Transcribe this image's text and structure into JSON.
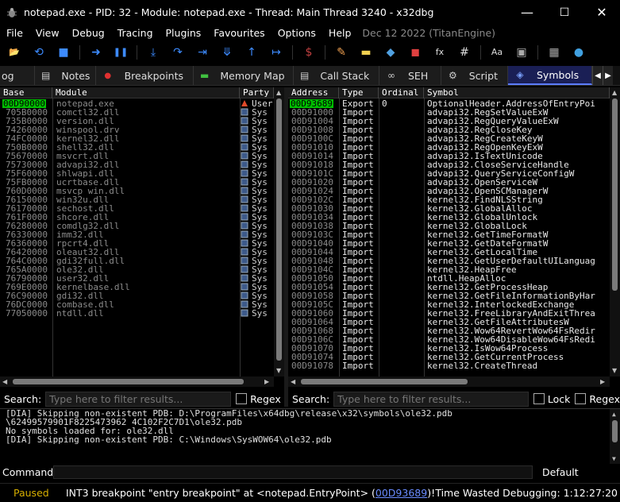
{
  "window": {
    "title": "notepad.exe - PID: 32 - Module: notepad.exe - Thread: Main Thread 3240 - x32dbg",
    "minimize": "—",
    "maximize": "☐",
    "close": "✕"
  },
  "menu": {
    "items": [
      "File",
      "View",
      "Debug",
      "Tracing",
      "Plugins",
      "Favourites",
      "Options",
      "Help"
    ],
    "date": "Dec 12 2022 (TitanEngine)"
  },
  "toolbar": {
    "icons": [
      "open-icon",
      "restart-icon",
      "stop-icon",
      "run-icon",
      "pause-icon",
      "step-into-icon",
      "step-over-icon",
      "trace-into-icon",
      "trace-over-icon",
      "execute-till-return-icon",
      "run-to-user-code-icon",
      "script-icon",
      "patch-icon",
      "comment-icon",
      "label-icon",
      "bookmark-icon",
      "function-icon",
      "hash-icon",
      "font-icon",
      "memory-icon",
      "calculator-icon",
      "globe-icon"
    ],
    "glyphs": [
      "📂",
      "⟲",
      "■",
      "➜",
      "❚❚",
      "⤓",
      "↷",
      "⇥",
      "⤋",
      "↑",
      "↦",
      "$",
      "✎",
      "▬",
      "◆",
      "◼",
      "fx",
      "#",
      "Aa",
      "▣",
      "▦",
      "●"
    ],
    "colors": [
      "#e0a030",
      "#3d8bff",
      "#3d8bff",
      "#3d8bff",
      "#3d8bff",
      "#3d8bff",
      "#3d8bff",
      "#3d8bff",
      "#3d8bff",
      "#3d8bff",
      "#3d8bff",
      "#c04040",
      "#f0a050",
      "#f0d050",
      "#50a0e0",
      "#e04040",
      "#dddddd",
      "#dddddd",
      "#dddddd",
      "#aaaaaa",
      "#aaaaaa",
      "#40a0e0"
    ]
  },
  "tabs": [
    {
      "label": "og",
      "icon": ""
    },
    {
      "label": "Notes",
      "icon": "▤"
    },
    {
      "label": "Breakpoints",
      "icon": "●"
    },
    {
      "label": "Memory Map",
      "icon": "▬"
    },
    {
      "label": "Call Stack",
      "icon": "▤"
    },
    {
      "label": "SEH",
      "icon": "∞"
    },
    {
      "label": "Script",
      "icon": "⚙"
    },
    {
      "label": "Symbols",
      "icon": "◈"
    }
  ],
  "tab_scroll": {
    "left": "◀",
    "right": "▶"
  },
  "modules": {
    "headers": [
      "Base",
      "Module",
      "Party"
    ],
    "rows": [
      {
        "base": "00D90000",
        "module": "notepad.exe",
        "party": "User",
        "selected": true
      },
      {
        "base": "705B0000",
        "module": "comctl32.dll",
        "party": "Sys"
      },
      {
        "base": "735B0000",
        "module": "version.dll",
        "party": "Sys"
      },
      {
        "base": "74260000",
        "module": "winspool.drv",
        "party": "Sys"
      },
      {
        "base": "74FC0000",
        "module": "kernel32.dll",
        "party": "Sys"
      },
      {
        "base": "750B0000",
        "module": "shell32.dll",
        "party": "Sys"
      },
      {
        "base": "75670000",
        "module": "msvcrt.dll",
        "party": "Sys"
      },
      {
        "base": "75730000",
        "module": "advapi32.dll",
        "party": "Sys"
      },
      {
        "base": "75F60000",
        "module": "shlwapi.dll",
        "party": "Sys"
      },
      {
        "base": "75FB0000",
        "module": "ucrtbase.dll",
        "party": "Sys"
      },
      {
        "base": "760D0000",
        "module": "msvcp_win.dll",
        "party": "Sys"
      },
      {
        "base": "76150000",
        "module": "win32u.dll",
        "party": "Sys"
      },
      {
        "base": "76170000",
        "module": "sechost.dll",
        "party": "Sys"
      },
      {
        "base": "761F0000",
        "module": "shcore.dll",
        "party": "Sys"
      },
      {
        "base": "76280000",
        "module": "comdlg32.dll",
        "party": "Sys"
      },
      {
        "base": "76330000",
        "module": "imm32.dll",
        "party": "Sys"
      },
      {
        "base": "76360000",
        "module": "rpcrt4.dll",
        "party": "Sys"
      },
      {
        "base": "76420000",
        "module": "oleaut32.dll",
        "party": "Sys"
      },
      {
        "base": "764C0000",
        "module": "gdi32full.dll",
        "party": "Sys"
      },
      {
        "base": "765A0000",
        "module": "ole32.dll",
        "party": "Sys"
      },
      {
        "base": "76790000",
        "module": "user32.dll",
        "party": "Sys"
      },
      {
        "base": "769E0000",
        "module": "kernelbase.dll",
        "party": "Sys"
      },
      {
        "base": "76C90000",
        "module": "gdi32.dll",
        "party": "Sys"
      },
      {
        "base": "76DC0000",
        "module": "combase.dll",
        "party": "Sys"
      },
      {
        "base": "77050000",
        "module": "ntdll.dll",
        "party": "Sys"
      }
    ]
  },
  "symbols": {
    "headers": [
      "Address",
      "Type",
      "Ordinal",
      "Symbol"
    ],
    "rows": [
      {
        "address": "00D93689",
        "type": "Export",
        "ordinal": "0",
        "symbol": "OptionalHeader.AddressOfEntryPoi",
        "selected": true
      },
      {
        "address": "00D91000",
        "type": "Import",
        "ordinal": "",
        "symbol": "advapi32.RegSetValueExW"
      },
      {
        "address": "00D91004",
        "type": "Import",
        "ordinal": "",
        "symbol": "advapi32.RegQueryValueExW"
      },
      {
        "address": "00D91008",
        "type": "Import",
        "ordinal": "",
        "symbol": "advapi32.RegCloseKey"
      },
      {
        "address": "00D9100C",
        "type": "Import",
        "ordinal": "",
        "symbol": "advapi32.RegCreateKeyW"
      },
      {
        "address": "00D91010",
        "type": "Import",
        "ordinal": "",
        "symbol": "advapi32.RegOpenKeyExW"
      },
      {
        "address": "00D91014",
        "type": "Import",
        "ordinal": "",
        "symbol": "advapi32.IsTextUnicode"
      },
      {
        "address": "00D91018",
        "type": "Import",
        "ordinal": "",
        "symbol": "advapi32.CloseServiceHandle"
      },
      {
        "address": "00D9101C",
        "type": "Import",
        "ordinal": "",
        "symbol": "advapi32.QueryServiceConfigW"
      },
      {
        "address": "00D91020",
        "type": "Import",
        "ordinal": "",
        "symbol": "advapi32.OpenServiceW"
      },
      {
        "address": "00D91024",
        "type": "Import",
        "ordinal": "",
        "symbol": "advapi32.OpenSCManagerW"
      },
      {
        "address": "00D9102C",
        "type": "Import",
        "ordinal": "",
        "symbol": "kernel32.FindNLSString"
      },
      {
        "address": "00D91030",
        "type": "Import",
        "ordinal": "",
        "symbol": "kernel32.GlobalAlloc"
      },
      {
        "address": "00D91034",
        "type": "Import",
        "ordinal": "",
        "symbol": "kernel32.GlobalUnlock"
      },
      {
        "address": "00D91038",
        "type": "Import",
        "ordinal": "",
        "symbol": "kernel32.GlobalLock"
      },
      {
        "address": "00D9103C",
        "type": "Import",
        "ordinal": "",
        "symbol": "kernel32.GetTimeFormatW"
      },
      {
        "address": "00D91040",
        "type": "Import",
        "ordinal": "",
        "symbol": "kernel32.GetDateFormatW"
      },
      {
        "address": "00D91044",
        "type": "Import",
        "ordinal": "",
        "symbol": "kernel32.GetLocalTime"
      },
      {
        "address": "00D91048",
        "type": "Import",
        "ordinal": "",
        "symbol": "kernel32.GetUserDefaultUILanguag"
      },
      {
        "address": "00D9104C",
        "type": "Import",
        "ordinal": "",
        "symbol": "kernel32.HeapFree"
      },
      {
        "address": "00D91050",
        "type": "Import",
        "ordinal": "",
        "symbol": "ntdll.HeapAlloc"
      },
      {
        "address": "00D91054",
        "type": "Import",
        "ordinal": "",
        "symbol": "kernel32.GetProcessHeap"
      },
      {
        "address": "00D91058",
        "type": "Import",
        "ordinal": "",
        "symbol": "kernel32.GetFileInformationByHar"
      },
      {
        "address": "00D9105C",
        "type": "Import",
        "ordinal": "",
        "symbol": "kernel32.InterlockedExchange"
      },
      {
        "address": "00D91060",
        "type": "Import",
        "ordinal": "",
        "symbol": "kernel32.FreeLibraryAndExitThrea"
      },
      {
        "address": "00D91064",
        "type": "Import",
        "ordinal": "",
        "symbol": "kernel32.GetFileAttributesW"
      },
      {
        "address": "00D91068",
        "type": "Import",
        "ordinal": "",
        "symbol": "kernel32.Wow64RevertWow64FsRedir"
      },
      {
        "address": "00D9106C",
        "type": "Import",
        "ordinal": "",
        "symbol": "kernel32.Wow64DisableWow64FsRedi"
      },
      {
        "address": "00D91070",
        "type": "Import",
        "ordinal": "",
        "symbol": "kernel32.IsWow64Process"
      },
      {
        "address": "00D91074",
        "type": "Import",
        "ordinal": "",
        "symbol": "kernel32.GetCurrentProcess"
      },
      {
        "address": "00D91078",
        "type": "Import",
        "ordinal": "",
        "symbol": "kernel32.CreateThread"
      }
    ]
  },
  "search_left": {
    "label": "Search:",
    "placeholder": "Type here to filter results...",
    "regex": "Regex"
  },
  "search_right": {
    "label": "Search:",
    "placeholder": "Type here to filter results...",
    "lock": "Lock",
    "regex": "Regex"
  },
  "log": {
    "lines": [
      "[DIA] Skipping non-existent PDB: D:\\ProgramFiles\\x64dbg\\release\\x32\\symbols\\ole32.pdb",
      "\\62499579901F8225473962 4C102F2C7D1\\ole32.pdb",
      "No symbols loaded for: ole32.dll",
      "[DIA] Skipping non-existent PDB: C:\\Windows\\SysWOW64\\ole32.pdb"
    ]
  },
  "command": {
    "label": "Command:",
    "default": "Default"
  },
  "status": {
    "state": "Paused",
    "message_prefix": "INT3 breakpoint \"entry breakpoint\" at <notepad.EntryPoint> (",
    "message_link": "00D93689",
    "message_suffix": ")!",
    "time": "Time Wasted Debugging: 1:12:27:20"
  },
  "colors": {
    "accent": "#1a1f55",
    "selection": "#00c000",
    "paused": "#d8b000",
    "link": "#6a8cff"
  }
}
